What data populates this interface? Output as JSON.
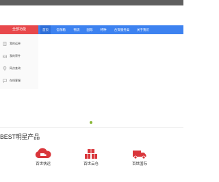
{
  "topbar": {
    "left_text": "",
    "right_links": [
      "",
      ""
    ]
  },
  "nav": {
    "category_button": "全部功能",
    "items": [
      {
        "label": "首页",
        "active": true
      },
      {
        "label": "信保箱",
        "active": false
      },
      {
        "label": "物流",
        "active": false
      },
      {
        "label": "国际",
        "active": false
      },
      {
        "label": "特种",
        "active": false
      },
      {
        "label": "合资服务类",
        "active": false
      },
      {
        "label": "关于我们",
        "active": false
      }
    ]
  },
  "sidebar": {
    "items": [
      {
        "label": "我的运单",
        "icon": "document-icon"
      },
      {
        "label": "我的寄件",
        "icon": "inbox-icon"
      },
      {
        "label": "网点查询",
        "icon": "location-pin-icon"
      },
      {
        "label": "在线客服",
        "icon": "chat-icon"
      }
    ]
  },
  "carousel": {
    "active_index": 0,
    "count": 1
  },
  "section": {
    "title": "BEST明星产品"
  },
  "products": [
    {
      "name": "百世快运",
      "icon": "cloud-truck-icon",
      "desc": ""
    },
    {
      "name": "百世云仓",
      "icon": "warehouse-boxes-icon",
      "desc": ""
    },
    {
      "name": "百世国际",
      "icon": "truck-icon",
      "desc": ""
    }
  ],
  "colors": {
    "brand_red": "#e8484b",
    "nav_blue": "#3d82f0",
    "nav_active": "#2f6fd8",
    "topbar": "#5f5f5f",
    "carousel_dot": "#8ab839",
    "product_icon": "#d9363b"
  }
}
